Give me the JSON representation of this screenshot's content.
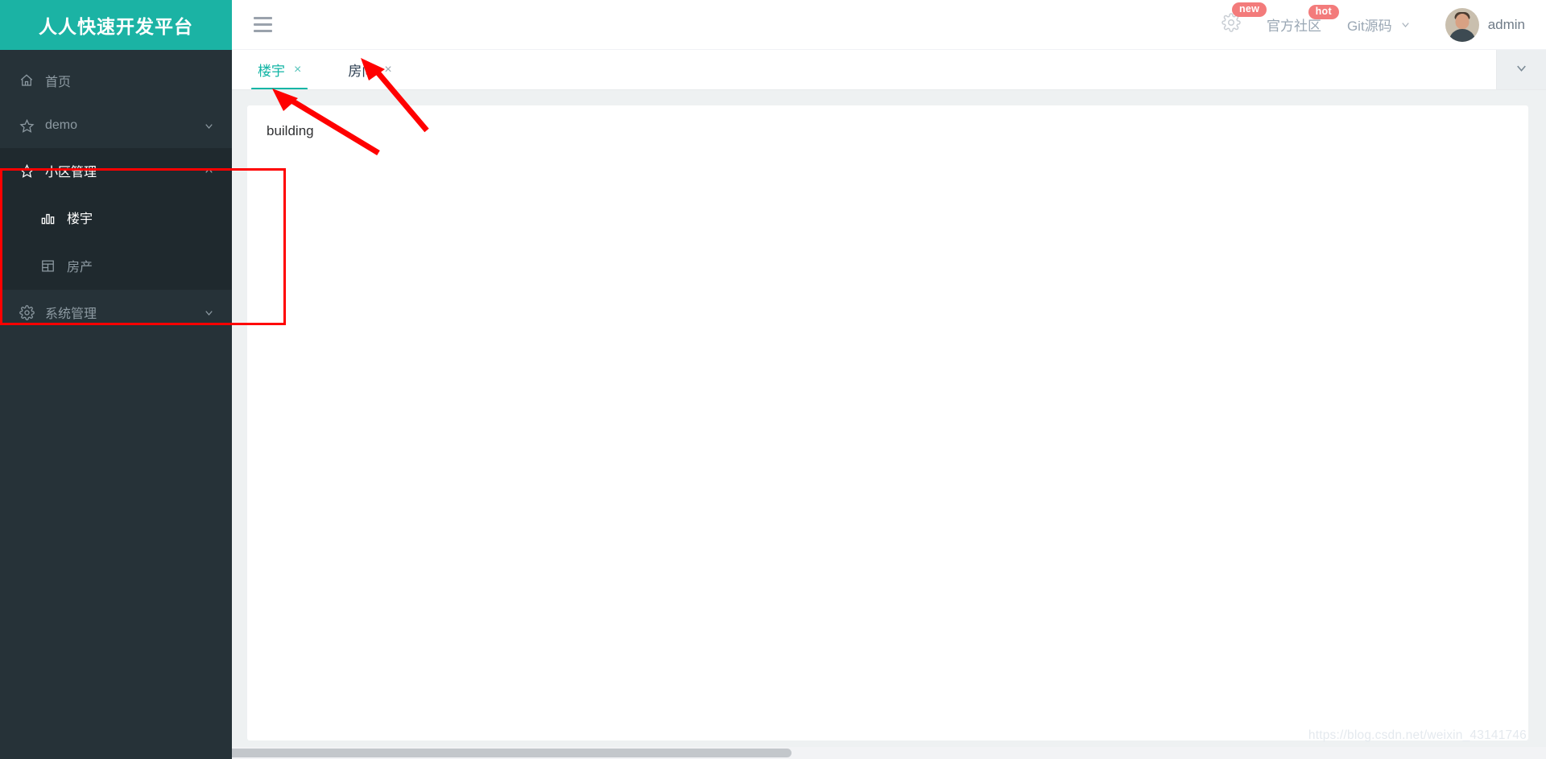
{
  "brand": {
    "title": "人人快速开发平台",
    "bg": "#1bb3a4"
  },
  "sidebar": {
    "items": [
      {
        "label": "首页",
        "icon": "home-icon",
        "type": "item"
      },
      {
        "label": "demo",
        "icon": "star-icon",
        "type": "group",
        "expanded": false
      },
      {
        "label": "小区管理",
        "icon": "star-icon",
        "type": "group",
        "expanded": true,
        "children": [
          {
            "label": "楼宇",
            "icon": "chart-bar-icon",
            "active": true
          },
          {
            "label": "房产",
            "icon": "table-icon",
            "active": false
          }
        ]
      },
      {
        "label": "系统管理",
        "icon": "gear-icon",
        "type": "group",
        "expanded": false
      }
    ]
  },
  "header": {
    "menu_toggle": "hamburger-icon",
    "settings_badge": "new",
    "community_label": "官方社区",
    "community_badge": "hot",
    "git_label": "Git源码",
    "username": "admin"
  },
  "tabs": {
    "items": [
      {
        "label": "楼宇",
        "active": true,
        "close": "×"
      },
      {
        "label": "房间",
        "active": false,
        "close": "×"
      }
    ],
    "dropdown_icon": "chevron-down-icon"
  },
  "content": {
    "card_title": "building"
  },
  "watermark": "https://blog.csdn.net/weixin_43141746",
  "colors": {
    "accent": "#1bb3a4",
    "sidebar_bg": "#263238",
    "sidebar_active_bg": "#1f292e",
    "badge_red": "#f37b7b",
    "annotation_red": "#ff0000"
  }
}
